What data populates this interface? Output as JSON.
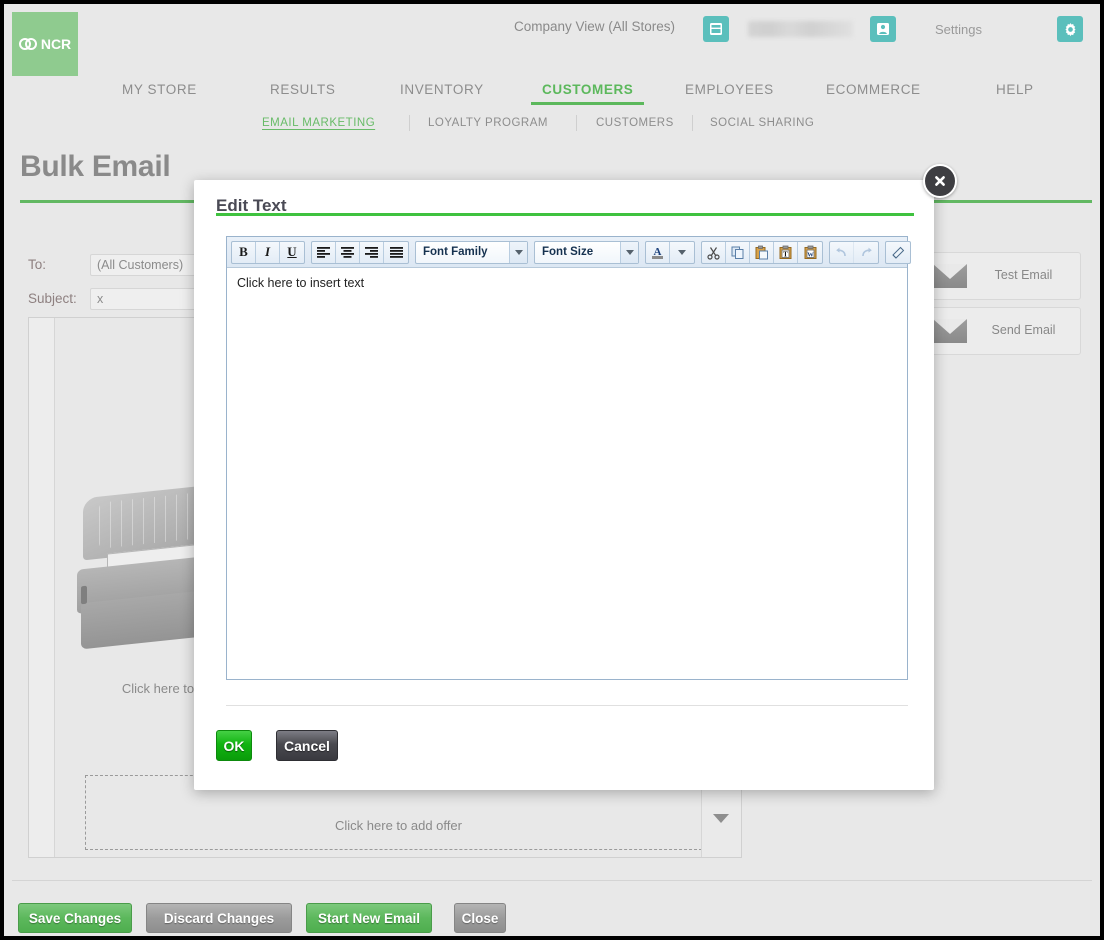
{
  "header": {
    "logo_text": "NCR",
    "company_view": "Company View (All Stores)",
    "store_icon": "store-icon",
    "user_icon": "user-icon",
    "settings_label": "Settings",
    "gear_icon": "gear-icon"
  },
  "mainnav": [
    {
      "label": "MY STORE",
      "active": false
    },
    {
      "label": "RESULTS",
      "active": false
    },
    {
      "label": "INVENTORY",
      "active": false
    },
    {
      "label": "CUSTOMERS",
      "active": true
    },
    {
      "label": "EMPLOYEES",
      "active": false
    },
    {
      "label": "ECOMMERCE",
      "active": false
    },
    {
      "label": "HELP",
      "active": false
    }
  ],
  "subnav": [
    {
      "label": "EMAIL MARKETING",
      "active": true
    },
    {
      "label": "LOYALTY PROGRAM",
      "active": false
    },
    {
      "label": "CUSTOMERS",
      "active": false
    },
    {
      "label": "SOCIAL SHARING",
      "active": false
    }
  ],
  "page": {
    "title": "Bulk Email",
    "to_label": "To:",
    "to_value": "(All Customers)",
    "subject_label": "Subject:",
    "subject_value": "x",
    "test_email_label": "Test Email",
    "send_email_label": "Send Email",
    "preview_insert_text": "Click here to insert text",
    "offer_text": "Click here to add offer"
  },
  "footer": {
    "buttons": [
      {
        "label": "Save Changes",
        "style": "green"
      },
      {
        "label": "Discard Changes",
        "style": "grey"
      },
      {
        "label": "Start New Email",
        "style": "green"
      },
      {
        "label": "Close",
        "style": "grey"
      }
    ]
  },
  "modal": {
    "title": "Edit Text",
    "close_icon": "close-icon",
    "editor_placeholder": "Click here to insert text",
    "ok_label": "OK",
    "cancel_label": "Cancel",
    "toolbar": {
      "bold": "B",
      "italic": "I",
      "underline": "U",
      "align_left": "align-left-icon",
      "align_center": "align-center-icon",
      "align_right": "align-right-icon",
      "align_justify": "align-justify-icon",
      "font_family_label": "Font Family",
      "font_size_label": "Font Size",
      "font_color": "font-color-icon",
      "cut": "cut-icon",
      "copy": "copy-icon",
      "paste": "paste-icon",
      "paste_text": "paste-as-text-icon",
      "paste_word": "paste-from-word-icon",
      "undo": "undo-icon",
      "redo": "redo-icon",
      "remove_format": "remove-format-icon"
    }
  },
  "colors": {
    "brand_green": "#5cb85c",
    "accent_teal": "#5bbfbc",
    "page_bg": "#e8e8e8",
    "modal_rule": "#3fc23f"
  }
}
